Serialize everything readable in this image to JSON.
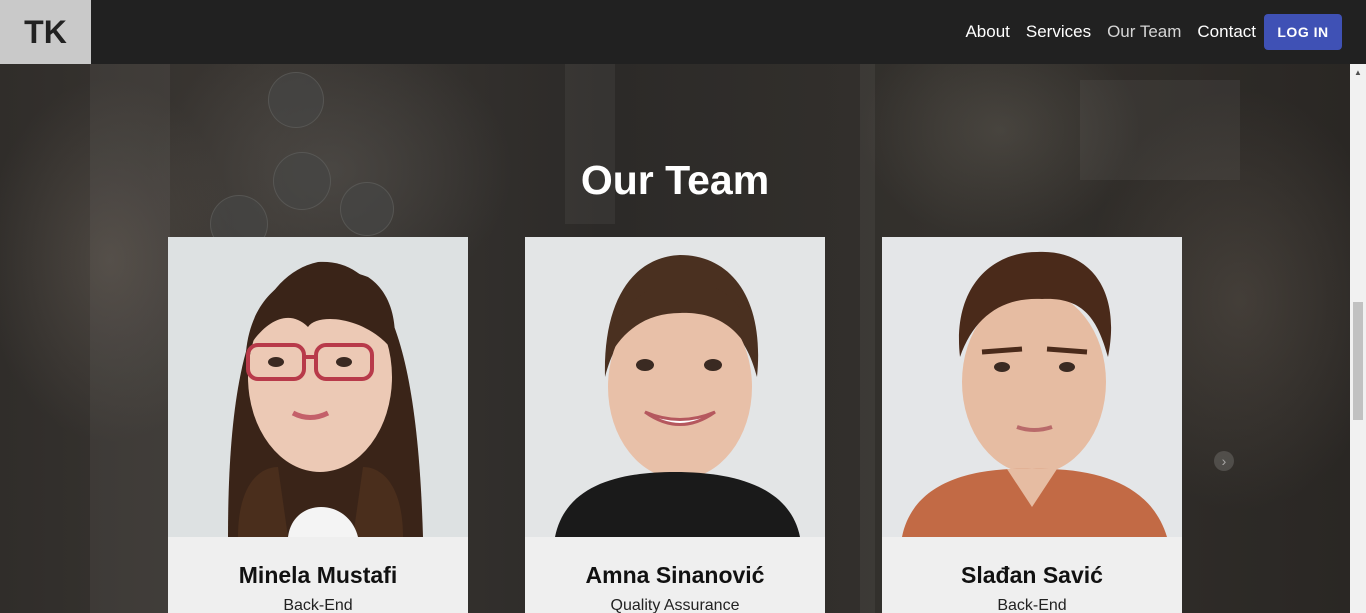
{
  "header": {
    "logo": "TK",
    "nav": [
      "About",
      "Services",
      "Our Team",
      "Contact"
    ],
    "active_nav": "Our Team",
    "login_label": "LOG IN"
  },
  "section": {
    "title": "Our Team"
  },
  "team": [
    {
      "name": "Minela Mustafi",
      "role": "Back-End"
    },
    {
      "name": "Amna Sinanović",
      "role": "Quality Assurance"
    },
    {
      "name": "Slađan Savić",
      "role": "Back-End"
    }
  ],
  "colors": {
    "navbar": "#212121",
    "logo_bg": "#c9c9c9",
    "accent": "#3f51b5",
    "card_bg": "#efefef"
  },
  "icons": {
    "carousel_next": "chevron-right-icon",
    "scroll_up": "scroll-up-arrow-icon"
  }
}
